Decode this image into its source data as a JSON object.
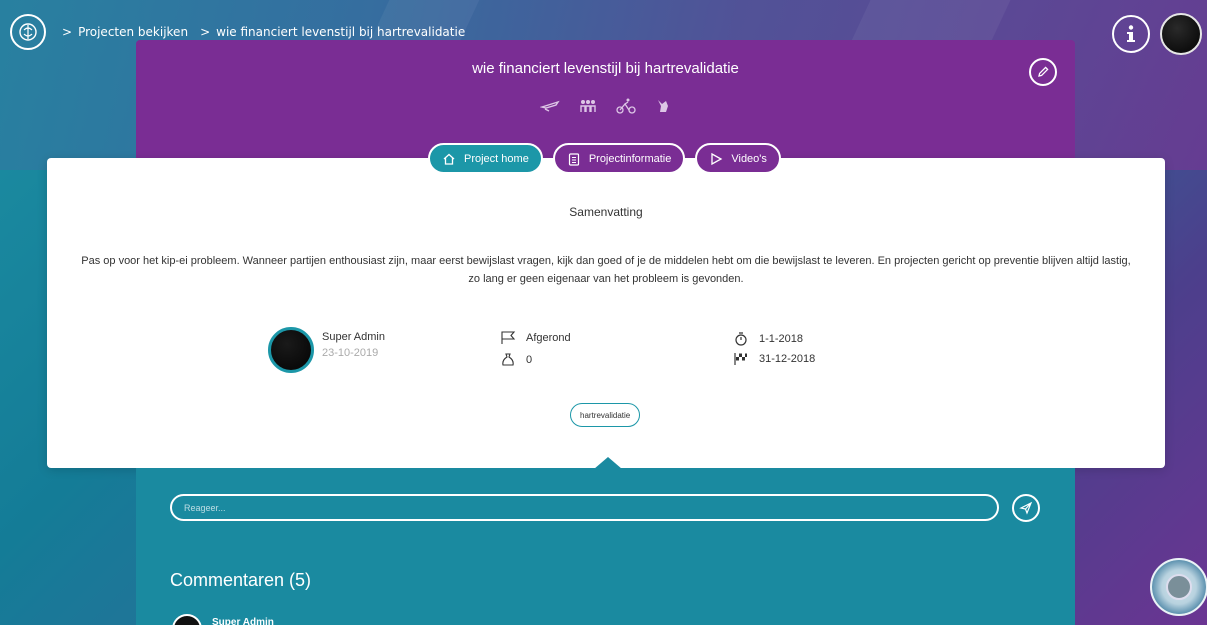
{
  "breadcrumb": {
    "items": [
      {
        "label": "Projecten bekijken"
      },
      {
        "label": "wie financiert levenstijl bij hartrevalidatie"
      }
    ],
    "separator": ">"
  },
  "project": {
    "title": "wie financiert levenstijl bij hartrevalidatie",
    "theme_icons": [
      "plane-icon",
      "people-icon",
      "cyclist-icon",
      "chess-icon"
    ]
  },
  "tabs": [
    {
      "label": "Project home",
      "icon": "home-icon",
      "active": true
    },
    {
      "label": "Projectinformatie",
      "icon": "clipboard-icon",
      "active": false
    },
    {
      "label": "Video's",
      "icon": "play-icon",
      "active": false
    }
  ],
  "summary": {
    "title": "Samenvatting",
    "text": "Pas op voor het kip-ei probleem. Wanneer partijen enthousiast zijn, maar eerst bewijslast vragen, kijk dan goed of je de middelen hebt om die bewijslast te leveren. En projecten gericht op preventie blijven altijd lastig, zo lang er geen eigenaar van het probleem is gevonden."
  },
  "meta": {
    "author_name": "Super Admin",
    "author_date": "23-10-2019",
    "status": "Afgerond",
    "budget": "0",
    "start_date": "1-1-2018",
    "end_date": "31-12-2018"
  },
  "tag": "hartrevalidatie",
  "comment": {
    "placeholder": "Reageer...",
    "heading": "Commentaren (5)",
    "first_author": "Super Admin"
  },
  "colors": {
    "purple": "#7a2d94",
    "teal": "#1a8aa0",
    "accent": "#1c97a8"
  }
}
